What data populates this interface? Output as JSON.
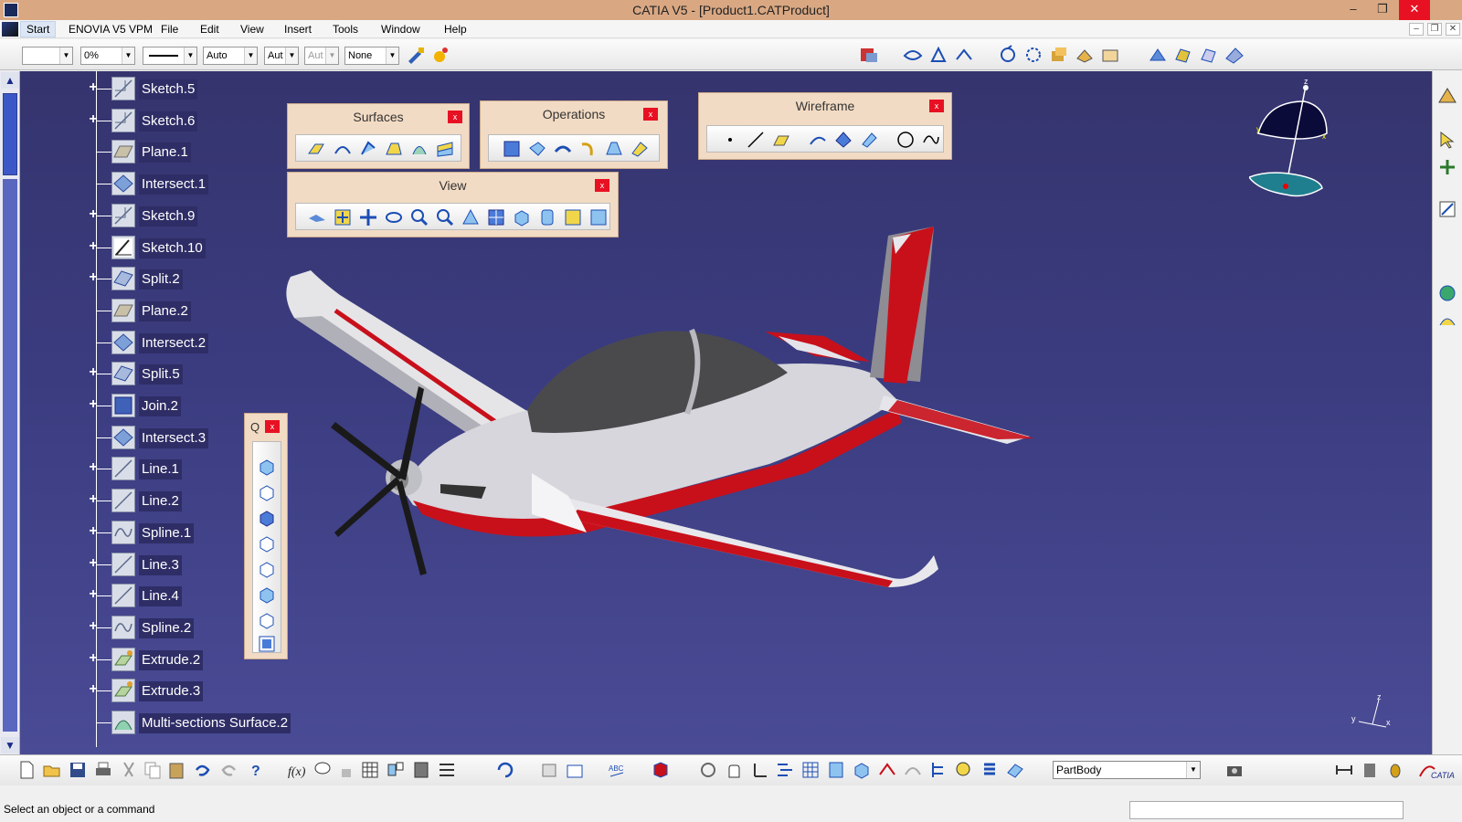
{
  "window": {
    "title": "CATIA V5 - [Product1.CATProduct]",
    "minimize": "–",
    "restore": "❐",
    "close": "✕"
  },
  "menu": {
    "start": "Start",
    "enovia": "ENOVIA V5 VPM",
    "file": "File",
    "edit": "Edit",
    "view": "View",
    "insert": "Insert",
    "tools": "Tools",
    "window": "Window",
    "help": "Help"
  },
  "graphic_props": {
    "color": "",
    "transparency": "0%",
    "linetype": "",
    "thickness": "Auto",
    "point_symbol": "Aut",
    "layer_disabled": "Aut",
    "layer": "None"
  },
  "tree": {
    "items": [
      {
        "label": "Sketch.5",
        "expandable": true,
        "icon": "sketch-icon"
      },
      {
        "label": "Sketch.6",
        "expandable": true,
        "icon": "sketch-icon"
      },
      {
        "label": "Plane.1",
        "expandable": false,
        "icon": "plane-icon"
      },
      {
        "label": "Intersect.1",
        "expandable": false,
        "icon": "intersect-icon"
      },
      {
        "label": "Sketch.9",
        "expandable": true,
        "icon": "sketch-icon"
      },
      {
        "label": "Sketch.10",
        "expandable": true,
        "icon": "sketch-edit-icon"
      },
      {
        "label": "Split.2",
        "expandable": true,
        "icon": "split-icon"
      },
      {
        "label": "Plane.2",
        "expandable": false,
        "icon": "plane-icon"
      },
      {
        "label": "Intersect.2",
        "expandable": false,
        "icon": "intersect-icon"
      },
      {
        "label": "Split.5",
        "expandable": true,
        "icon": "split-icon"
      },
      {
        "label": "Join.2",
        "expandable": true,
        "icon": "join-icon"
      },
      {
        "label": "Intersect.3",
        "expandable": false,
        "icon": "intersect-icon"
      },
      {
        "label": "Line.1",
        "expandable": true,
        "icon": "line-icon"
      },
      {
        "label": "Line.2",
        "expandable": true,
        "icon": "line-icon"
      },
      {
        "label": "Spline.1",
        "expandable": true,
        "icon": "spline-icon"
      },
      {
        "label": "Line.3",
        "expandable": true,
        "icon": "line-icon"
      },
      {
        "label": "Line.4",
        "expandable": true,
        "icon": "line-icon"
      },
      {
        "label": "Spline.2",
        "expandable": true,
        "icon": "spline-icon"
      },
      {
        "label": "Extrude.2",
        "expandable": true,
        "icon": "extrude-icon"
      },
      {
        "label": "Extrude.3",
        "expandable": true,
        "icon": "extrude-icon"
      },
      {
        "label": "Multi-sections Surface.2",
        "expandable": false,
        "icon": "multi-sections-surface-icon"
      }
    ]
  },
  "toolbars": {
    "surfaces": {
      "title": "Surfaces",
      "close": "x"
    },
    "operations": {
      "title": "Operations",
      "close": "x"
    },
    "wireframe": {
      "title": "Wireframe",
      "close": "x"
    },
    "view": {
      "title": "View",
      "close": "x"
    },
    "quick_view": {
      "title": "Q",
      "close": "x"
    }
  },
  "workbench": {
    "current_body": "PartBody"
  },
  "status": {
    "message": "Select an object or a command"
  },
  "colors": {
    "titlebar": "#d9a883",
    "viewport_top": "#35346e",
    "viewport_bottom": "#4a4b95",
    "aircraft_red": "#c8101b",
    "floating_toolbar": "#f2dbc4",
    "close_red": "#e81123"
  }
}
